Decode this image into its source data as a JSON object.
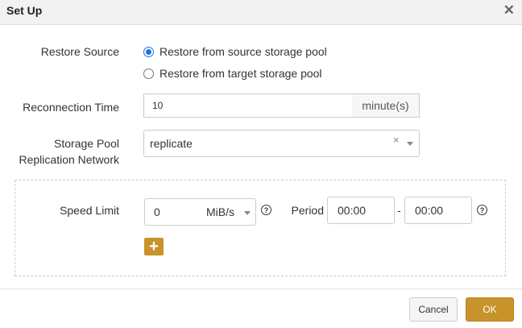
{
  "dialog": {
    "title": "Set Up",
    "close_glyph": "✕"
  },
  "restore_source": {
    "label": "Restore Source",
    "options": [
      {
        "label": "Restore from source storage pool",
        "checked": true
      },
      {
        "label": "Restore from target storage pool",
        "checked": false
      }
    ]
  },
  "reconnection_time": {
    "label": "Reconnection Time",
    "value": "10",
    "unit": "minute(s)"
  },
  "replication_network": {
    "label_line1": "Storage Pool",
    "label_line2": "Replication Network",
    "value": "replicate",
    "clear_glyph": "×"
  },
  "speed_limit": {
    "label": "Speed Limit",
    "value": "0",
    "unit": "MiB/s",
    "help_glyph": "?",
    "period_label": "Period",
    "period_start": "00:00",
    "separator": "-",
    "period_end": "00:00",
    "add_glyph": "+"
  },
  "footer": {
    "cancel_label": "Cancel",
    "ok_label": "OK"
  },
  "colors": {
    "accent": "#c8932a",
    "radio": "#1a73e8"
  }
}
